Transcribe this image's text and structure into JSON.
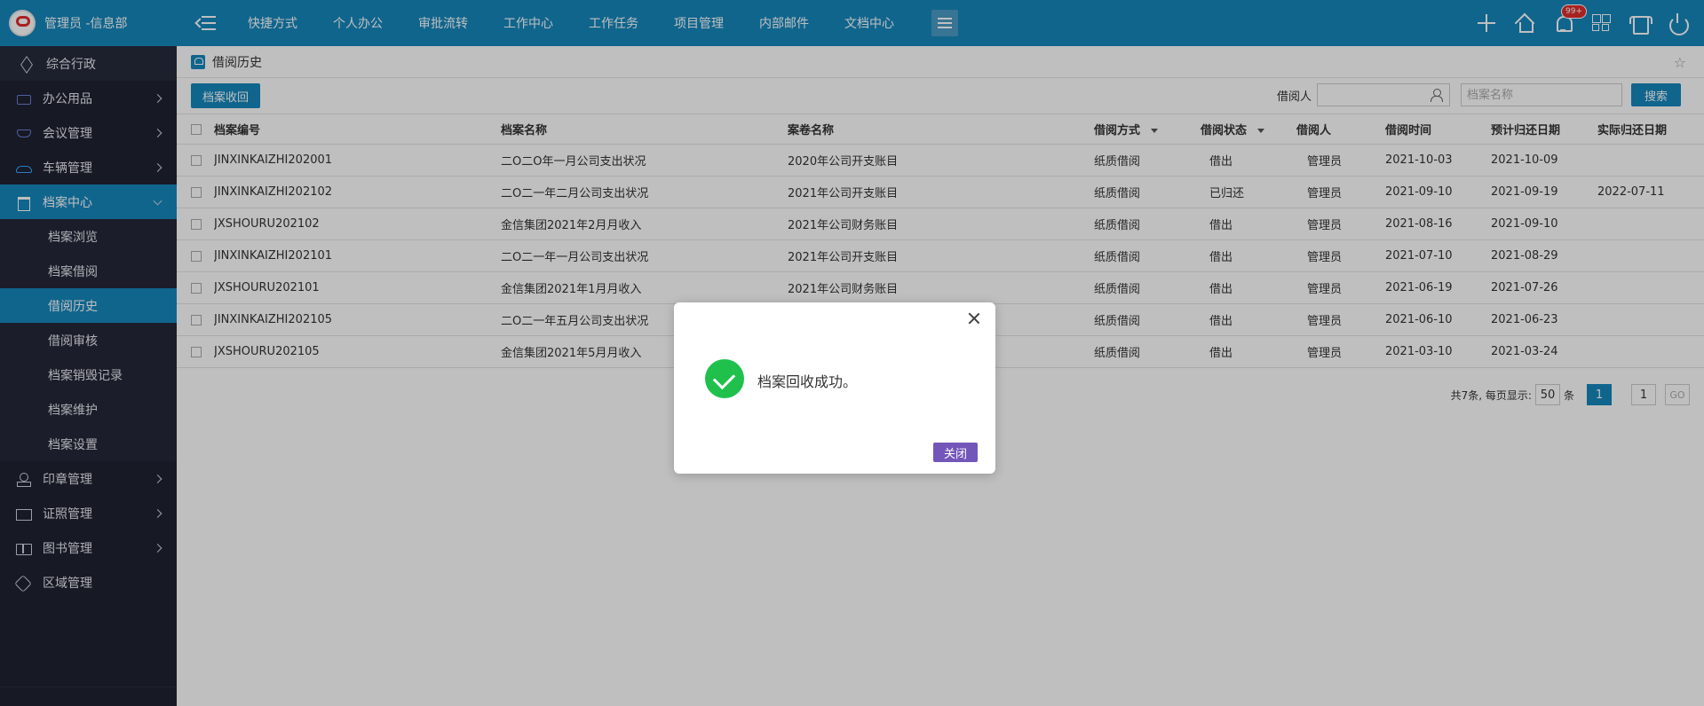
{
  "brand": {
    "title": "管理员 -信息部"
  },
  "topbar": {
    "nav": [
      "快捷方式",
      "个人办公",
      "审批流转",
      "工作中心",
      "工作任务",
      "项目管理",
      "内部邮件",
      "文档中心"
    ],
    "notification_badge": "99+"
  },
  "sidebar": {
    "items": [
      {
        "label": "综合行政",
        "icon": "layers-icon"
      },
      {
        "label": "办公用品",
        "icon": "printer-icon"
      },
      {
        "label": "会议管理",
        "icon": "meeting-icon"
      },
      {
        "label": "车辆管理",
        "icon": "car-icon"
      },
      {
        "label": "档案中心",
        "icon": "archive-icon"
      },
      {
        "label": "印章管理",
        "icon": "stamp-icon"
      },
      {
        "label": "证照管理",
        "icon": "id-card-icon"
      },
      {
        "label": "图书管理",
        "icon": "book-icon"
      },
      {
        "label": "区域管理",
        "icon": "region-icon"
      }
    ],
    "archive_sub": [
      "档案浏览",
      "档案借阅",
      "借阅历史",
      "借阅审核",
      "档案销毁记录",
      "档案维护",
      "档案设置"
    ]
  },
  "page": {
    "title": "借阅历史"
  },
  "toolbar": {
    "recycle_button": "档案收回",
    "borrower_label": "借阅人",
    "archive_name_placeholder": "档案名称",
    "search_button": "搜索"
  },
  "table": {
    "headers": [
      "档案编号",
      "档案名称",
      "案卷名称",
      "借阅方式",
      "借阅状态",
      "借阅人",
      "借阅时间",
      "预计归还日期",
      "实际归还日期"
    ],
    "rows": [
      [
        "JINXINKAIZHI202001",
        "二O二O年一月公司支出状况",
        "2020年公司开支账目",
        "纸质借阅",
        "借出",
        "管理员",
        "2021-10-03",
        "2021-10-09",
        ""
      ],
      [
        "JINXINKAIZHI202102",
        "二O二一年二月公司支出状况",
        "2021年公司开支账目",
        "纸质借阅",
        "已归还",
        "管理员",
        "2021-09-10",
        "2021-09-19",
        "2022-07-11"
      ],
      [
        "JXSHOURU202102",
        "金信集团2021年2月月收入",
        "2021年公司财务账目",
        "纸质借阅",
        "借出",
        "管理员",
        "2021-08-16",
        "2021-09-10",
        ""
      ],
      [
        "JINXINKAIZHI202101",
        "二O二一年一月公司支出状况",
        "2021年公司开支账目",
        "纸质借阅",
        "借出",
        "管理员",
        "2021-07-10",
        "2021-08-29",
        ""
      ],
      [
        "JXSHOURU202101",
        "金信集团2021年1月月收入",
        "2021年公司财务账目",
        "纸质借阅",
        "借出",
        "管理员",
        "2021-06-19",
        "2021-07-26",
        ""
      ],
      [
        "JINXINKAIZHI202105",
        "二O二一年五月公司支出状况",
        "",
        "纸质借阅",
        "借出",
        "管理员",
        "2021-06-10",
        "2021-06-23",
        ""
      ],
      [
        "JXSHOURU202105",
        "金信集团2021年5月月收入",
        "",
        "纸质借阅",
        "借出",
        "管理员",
        "2021-03-10",
        "2021-03-24",
        ""
      ]
    ]
  },
  "pager": {
    "summary": "共7条, 每页显示:",
    "page_size": "50",
    "unit": "条",
    "current_page": "1",
    "jump_value": "1",
    "go_label": "GO"
  },
  "dialog": {
    "message": "档案回收成功。",
    "close_button": "关闭"
  },
  "colors": {
    "primary": "#1687bd",
    "sidebar_bg": "#1f2232",
    "success": "#1fc14c",
    "dialog_button": "#7356b9"
  }
}
